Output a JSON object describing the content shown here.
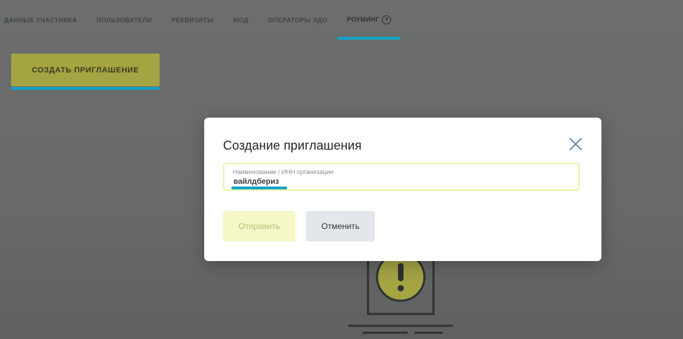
{
  "tabs": [
    {
      "label": "Данные участника"
    },
    {
      "label": "Пользователи"
    },
    {
      "label": "Реквизиты"
    },
    {
      "label": "МОД"
    },
    {
      "label": "Операторы ЭДО"
    },
    {
      "label": "Роуминг",
      "help": "?"
    }
  ],
  "page": {
    "create_invitation_label": "Создать приглашение"
  },
  "modal": {
    "title": "Создание приглашения",
    "field": {
      "label": "Наименование / ИНН организации",
      "value": "вайлдбериз"
    },
    "send_label": "Отправить",
    "cancel_label": "Отменить"
  },
  "colors": {
    "accent": "#12a4c8",
    "primary_button": "#a4a443",
    "overlay": "#6a6c6c"
  }
}
